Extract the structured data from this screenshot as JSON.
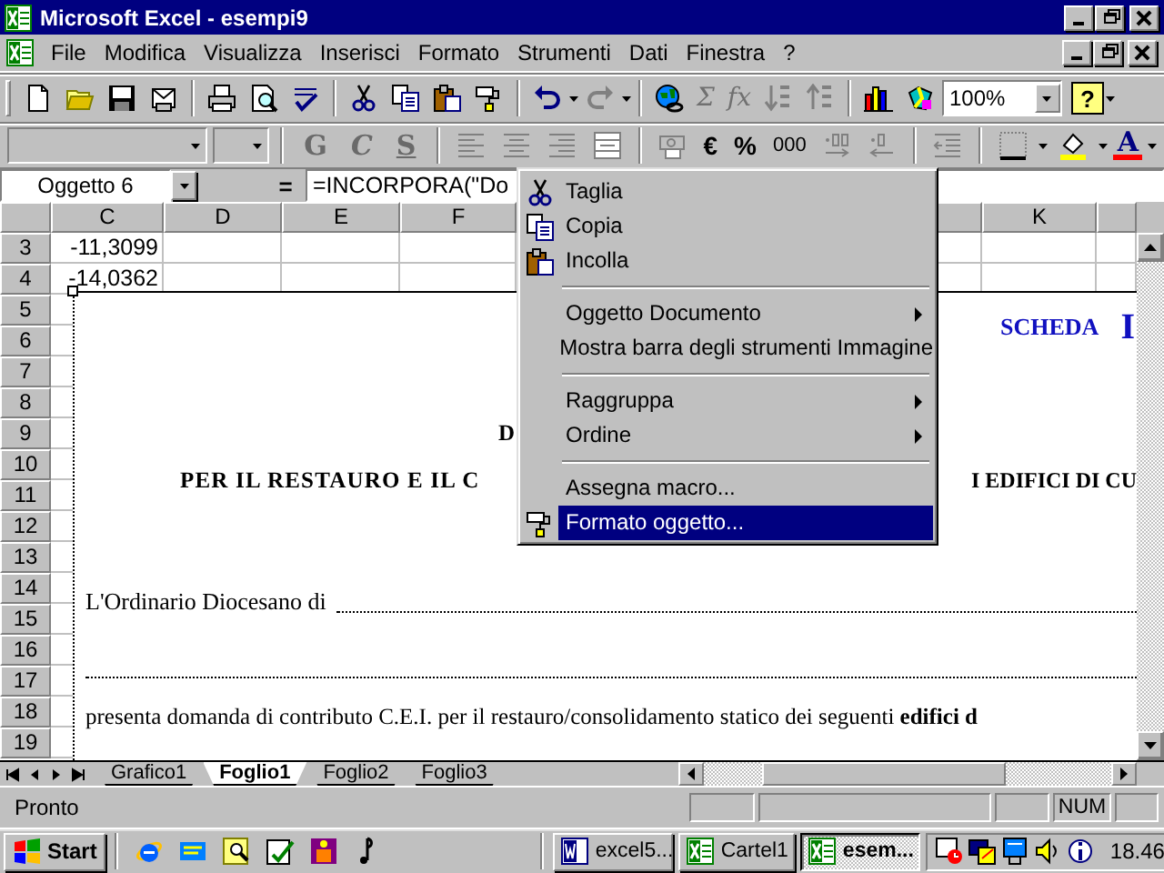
{
  "window": {
    "title": "Microsoft Excel - esempi9"
  },
  "menu": [
    "File",
    "Modifica",
    "Visualizza",
    "Inserisci",
    "Formato",
    "Strumenti",
    "Dati",
    "Finestra",
    "?"
  ],
  "standard_toolbar": {
    "sum_button": {
      "label": "Σ",
      "disabled": true
    },
    "function_button": {
      "label": "fx",
      "disabled": true
    },
    "zoom": "100%",
    "help_button": "?"
  },
  "formatting_toolbar": {
    "style_buttons": [
      {
        "label": "G",
        "disabled": true
      },
      {
        "label": "C",
        "disabled": true
      },
      {
        "label": "S",
        "disabled": true
      }
    ],
    "euro_button": "€",
    "percent_button": "%",
    "thousands_button": "000",
    "font_color_button": "A"
  },
  "formula_bar": {
    "name_box": "Oggetto 6",
    "equals": "=",
    "formula": "=INCORPORA(\"Do"
  },
  "sheet": {
    "columns": [
      "C",
      "D",
      "E",
      "F",
      "K"
    ],
    "rows": [
      {
        "number": "3",
        "cells": [
          "-11,3099"
        ]
      },
      {
        "number": "4",
        "cells": [
          "-14,0362"
        ]
      },
      {
        "number": "5"
      },
      {
        "number": "6"
      },
      {
        "number": "7"
      },
      {
        "number": "8"
      },
      {
        "number": "9"
      },
      {
        "number": "10"
      },
      {
        "number": "11"
      },
      {
        "number": "12"
      },
      {
        "number": "13"
      },
      {
        "number": "14"
      },
      {
        "number": "15"
      },
      {
        "number": "16"
      },
      {
        "number": "17"
      },
      {
        "number": "18"
      },
      {
        "number": "19"
      }
    ]
  },
  "embedded_document": {
    "heading": "SCHEDA",
    "heading_cut": "I",
    "title_cut": "D",
    "subtitle_left": "PER IL RESTAURO E IL C",
    "subtitle_right": "I EDIFICI DI CU",
    "field_label": "L'Ordinario Diocesano di",
    "body": "presenta domanda di contributo C.E.I. per il restauro/consolidamento statico dei seguenti **edifici d**"
  },
  "context_menu": [
    {
      "kind": "item",
      "label": "Taglia",
      "submenu": false,
      "selected": false
    },
    {
      "kind": "item",
      "label": "Copia",
      "submenu": false,
      "selected": false
    },
    {
      "kind": "item",
      "label": "Incolla",
      "submenu": false,
      "selected": false
    },
    {
      "kind": "separator"
    },
    {
      "kind": "item",
      "label": "Oggetto Documento",
      "submenu": true,
      "selected": false
    },
    {
      "kind": "item",
      "label": "Mostra barra degli strumenti Immagine",
      "submenu": false,
      "selected": false
    },
    {
      "kind": "separator"
    },
    {
      "kind": "item",
      "label": "Raggruppa",
      "submenu": true,
      "selected": false
    },
    {
      "kind": "item",
      "label": "Ordine",
      "submenu": true,
      "selected": false
    },
    {
      "kind": "separator"
    },
    {
      "kind": "item",
      "label": "Assegna macro...",
      "submenu": false,
      "selected": false
    },
    {
      "kind": "item",
      "label": "Formato oggetto...",
      "submenu": false,
      "selected": true
    }
  ],
  "sheet_tabs": [
    {
      "label": "Grafico1",
      "selected": false
    },
    {
      "label": "Foglio1",
      "selected": true
    },
    {
      "label": "Foglio2",
      "selected": false
    },
    {
      "label": "Foglio3",
      "selected": false
    }
  ],
  "status_bar": {
    "status": "Pronto",
    "num_lock": "NUM"
  },
  "taskbar": {
    "start": "Start",
    "tasks": [
      {
        "label": "excel5...",
        "kind": "word",
        "selected": false
      },
      {
        "label": "Cartel1",
        "kind": "excel",
        "selected": false
      },
      {
        "label": "esem...",
        "kind": "excel",
        "selected": true
      }
    ],
    "clock": "18.46"
  }
}
